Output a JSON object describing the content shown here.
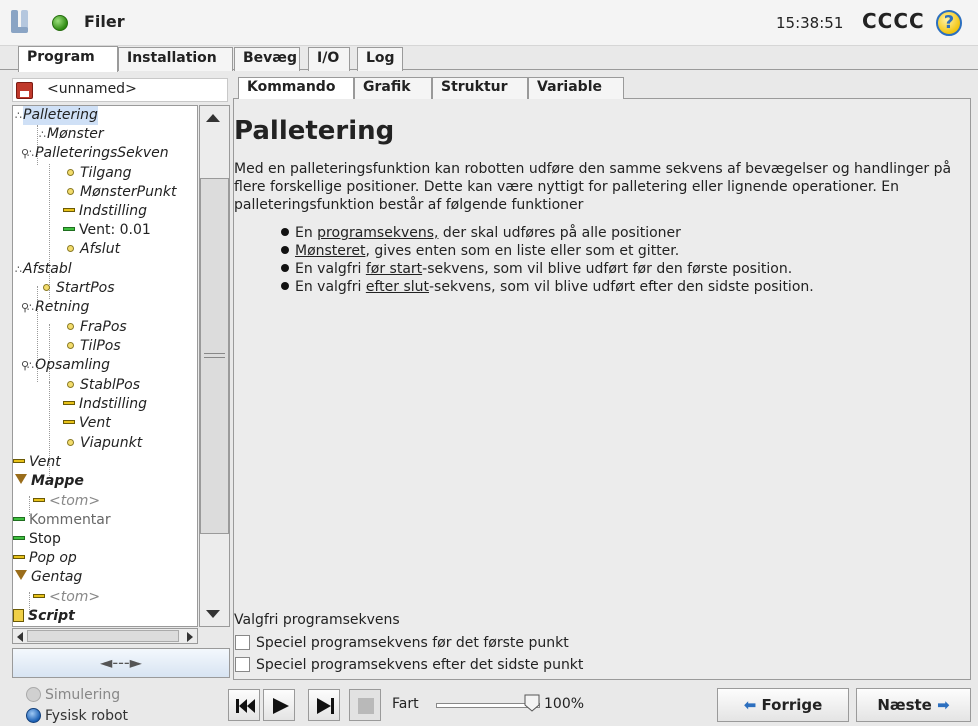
{
  "header": {
    "app_title": "Filer",
    "time": "15:38:51",
    "robot_name": "CCCC",
    "help_symbol": "?"
  },
  "main_tabs": [
    "Program",
    "Installation",
    "Bevæg",
    "I/O",
    "Log"
  ],
  "file": {
    "name": "<unnamed>"
  },
  "tree": [
    {
      "label": "Palletering",
      "icon": "palletize"
    },
    {
      "label": "Mønster",
      "icon": "palletize"
    },
    {
      "label": "PalleteringsSekven",
      "icon": "palletize"
    },
    {
      "label": "Tilgang",
      "icon": "waypoint"
    },
    {
      "label": "MønsterPunkt",
      "icon": "waypoint"
    },
    {
      "label": "Indstilling",
      "icon": "dash"
    },
    {
      "label": "Vent: 0.01",
      "icon": "dash-green"
    },
    {
      "label": "Afslut",
      "icon": "waypoint"
    },
    {
      "label": "Afstabl",
      "icon": "palletize"
    },
    {
      "label": "StartPos",
      "icon": "waypoint"
    },
    {
      "label": "Retning",
      "icon": "palletize"
    },
    {
      "label": "FraPos",
      "icon": "waypoint"
    },
    {
      "label": "TilPos",
      "icon": "waypoint"
    },
    {
      "label": "Opsamling",
      "icon": "palletize"
    },
    {
      "label": "StablPos",
      "icon": "waypoint"
    },
    {
      "label": "Indstilling",
      "icon": "dash"
    },
    {
      "label": "Vent",
      "icon": "dash"
    },
    {
      "label": "Viapunkt",
      "icon": "waypoint"
    },
    {
      "label": "Vent",
      "icon": "dash"
    },
    {
      "label": "Mappe",
      "icon": "folder"
    },
    {
      "label": "<tom>",
      "icon": "dash"
    },
    {
      "label": "Kommentar",
      "icon": "dash-green"
    },
    {
      "label": "Stop",
      "icon": "dash-green"
    },
    {
      "label": "Pop op",
      "icon": "dash"
    },
    {
      "label": "Gentag",
      "icon": "folder"
    },
    {
      "label": "<tom>",
      "icon": "dash"
    },
    {
      "label": "Script",
      "icon": "script"
    }
  ],
  "move_button": "◄---►",
  "sub_tabs": [
    "Kommando",
    "Grafik",
    "Struktur",
    "Variable"
  ],
  "content": {
    "title": "Palletering",
    "intro": "Med en palleteringsfunktion kan robotten udføre den samme sekvens af bevægelser og handlinger på flere forskellige positioner. Dette kan være nyttigt for palletering eller lignende operationer. En palleteringsfunktion består af følgende funktioner",
    "bullets": [
      {
        "pre": "En ",
        "link": "programsekvens,",
        "post": " der skal udføres på alle positioner"
      },
      {
        "pre": "",
        "link": "Mønsteret",
        "post": ", gives enten som en liste eller som et gitter."
      },
      {
        "pre": "En valgfri ",
        "link": "før start",
        "post": "-sekvens, som vil blive udført før den første position."
      },
      {
        "pre": "En valgfri ",
        "link": "efter slut",
        "post": "-sekvens, som vil blive udført efter den sidste position."
      }
    ],
    "optional_title": "Valgfri programsekvens",
    "checkbox_before": "Speciel programsekvens før det første punkt",
    "checkbox_after": "Speciel programsekvens efter det sidste punkt"
  },
  "bottom": {
    "simulation": "Simulering",
    "physical": "Fysisk robot",
    "speed_label": "Fart",
    "speed_value": "100%",
    "speed_fraction": 1.0,
    "prev_label": "Forrige",
    "next_label": "Næste"
  },
  "colors": {
    "accent": "#2c6fbf",
    "status_ok": "#2f8a12",
    "selection": "#cfe0f6"
  }
}
